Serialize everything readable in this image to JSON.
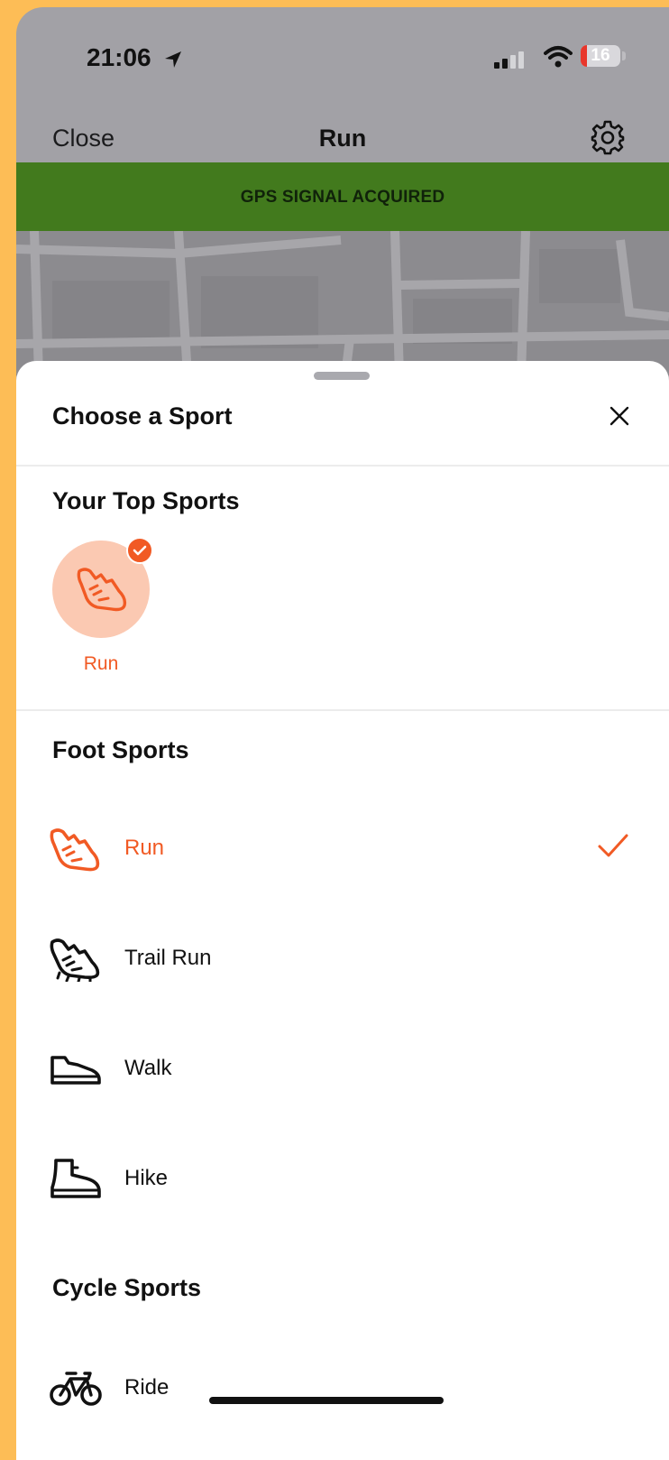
{
  "status_bar": {
    "time": "21:06",
    "battery": "16",
    "battery_level": 0.16
  },
  "nav": {
    "close_label": "Close",
    "title": "Run",
    "settings_icon": "gear-icon"
  },
  "gps_banner": {
    "text": "GPS SIGNAL ACQUIRED"
  },
  "sheet": {
    "title": "Choose a Sport",
    "close_icon": "close-icon",
    "top_sports": {
      "heading": "Your Top Sports",
      "items": [
        {
          "label": "Run",
          "icon": "shoe-icon",
          "selected": true
        }
      ]
    },
    "foot_sports": {
      "heading": "Foot Sports",
      "items": [
        {
          "label": "Run",
          "icon": "run-shoe-icon",
          "selected": true
        },
        {
          "label": "Trail Run",
          "icon": "trail-shoe-icon",
          "selected": false
        },
        {
          "label": "Walk",
          "icon": "walk-shoe-icon",
          "selected": false
        },
        {
          "label": "Hike",
          "icon": "hike-boot-icon",
          "selected": false
        }
      ]
    },
    "cycle_sports": {
      "heading": "Cycle Sports",
      "items": [
        {
          "label": "Ride",
          "icon": "bike-icon",
          "selected": false
        }
      ]
    }
  },
  "colors": {
    "accent": "#F15A24",
    "gps_banner": "#427A1D",
    "backdrop": "#FDBD56",
    "top_sport_bg": "#FBC9B2"
  }
}
